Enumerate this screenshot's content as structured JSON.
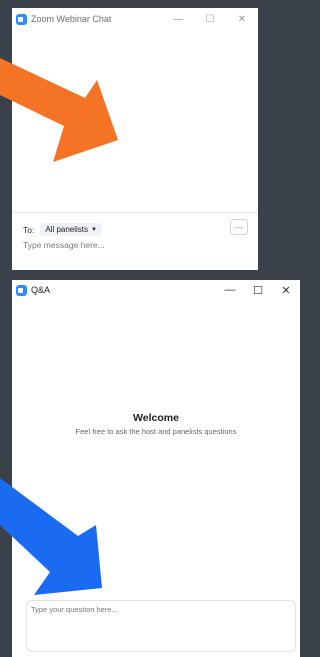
{
  "chat_window": {
    "title": "Zoom Webinar Chat",
    "controls": {
      "minimize": "—",
      "maximize": "☐",
      "close": "✕"
    },
    "to_label": "To:",
    "recipient": "All panelists",
    "more_label": "···",
    "message_placeholder": "Type message here..."
  },
  "qa_window": {
    "title": "Q&A",
    "controls": {
      "minimize": "—",
      "maximize": "☐",
      "close": "✕"
    },
    "welcome_title": "Welcome",
    "welcome_subtitle": "Feel free to ask the host and panelists questions",
    "question_placeholder": "Type your question here..."
  },
  "colors": {
    "background": "#3b414b",
    "zoom_blue": "#2d8cff",
    "orange_arrow": "#f47324",
    "blue_arrow": "#1b6bf2"
  }
}
